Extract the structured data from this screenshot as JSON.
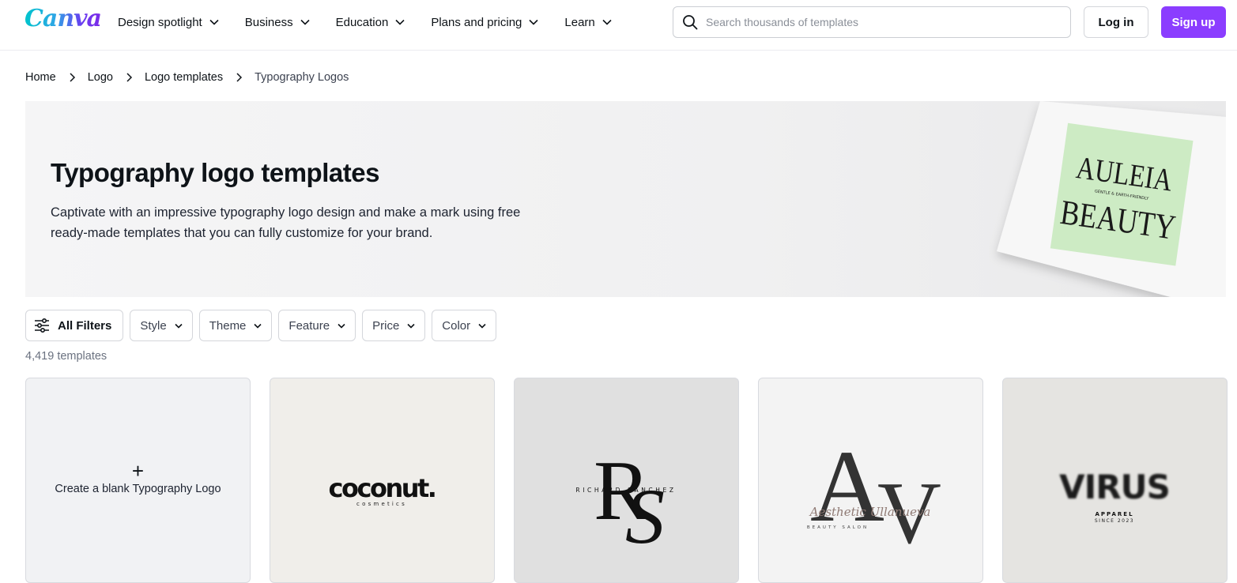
{
  "header": {
    "logo": "Canva",
    "nav": [
      {
        "label": "Design spotlight"
      },
      {
        "label": "Business"
      },
      {
        "label": "Education"
      },
      {
        "label": "Plans and pricing"
      },
      {
        "label": "Learn"
      }
    ],
    "search": {
      "placeholder": "Search thousands of templates",
      "value": ""
    },
    "login_label": "Log in",
    "signup_label": "Sign up",
    "accent_color": "#8b3dff"
  },
  "breadcrumb": [
    {
      "label": "Home"
    },
    {
      "label": "Logo"
    },
    {
      "label": "Logo templates"
    },
    {
      "label": "Typography Logos"
    }
  ],
  "hero": {
    "title": "Typography logo templates",
    "description": "Captivate with an impressive typography logo design and make a mark using free ready-made templates that you can fully customize for your brand.",
    "image": {
      "line1": "AULEIA",
      "tagline": "GENTLE & EARTH-FRIENDLY",
      "line2": "BEAUTY"
    }
  },
  "filters": {
    "all_label": "All Filters",
    "dropdowns": [
      {
        "label": "Style"
      },
      {
        "label": "Theme"
      },
      {
        "label": "Feature"
      },
      {
        "label": "Price"
      },
      {
        "label": "Color"
      }
    ]
  },
  "results_count": "4,419 templates",
  "templates": {
    "blank": {
      "label": "Create a blank Typography Logo"
    },
    "items": [
      {
        "title": "coconut.",
        "subtitle": "cosmetics",
        "bg": "#f0eeea"
      },
      {
        "title": "RS",
        "subtitle": "RICHARD SANCHEZ",
        "bg": "#e0e0e0"
      },
      {
        "title": "AV",
        "script": "Aesthetic Ullanueva",
        "subtitle": "BEAUTY SALON",
        "bg": "#f3f3f3"
      },
      {
        "title": "VIRUS",
        "subtitle": "APPAREL",
        "subtitle2": "SINCE 2023",
        "bg": "#e5e4e1"
      }
    ]
  }
}
